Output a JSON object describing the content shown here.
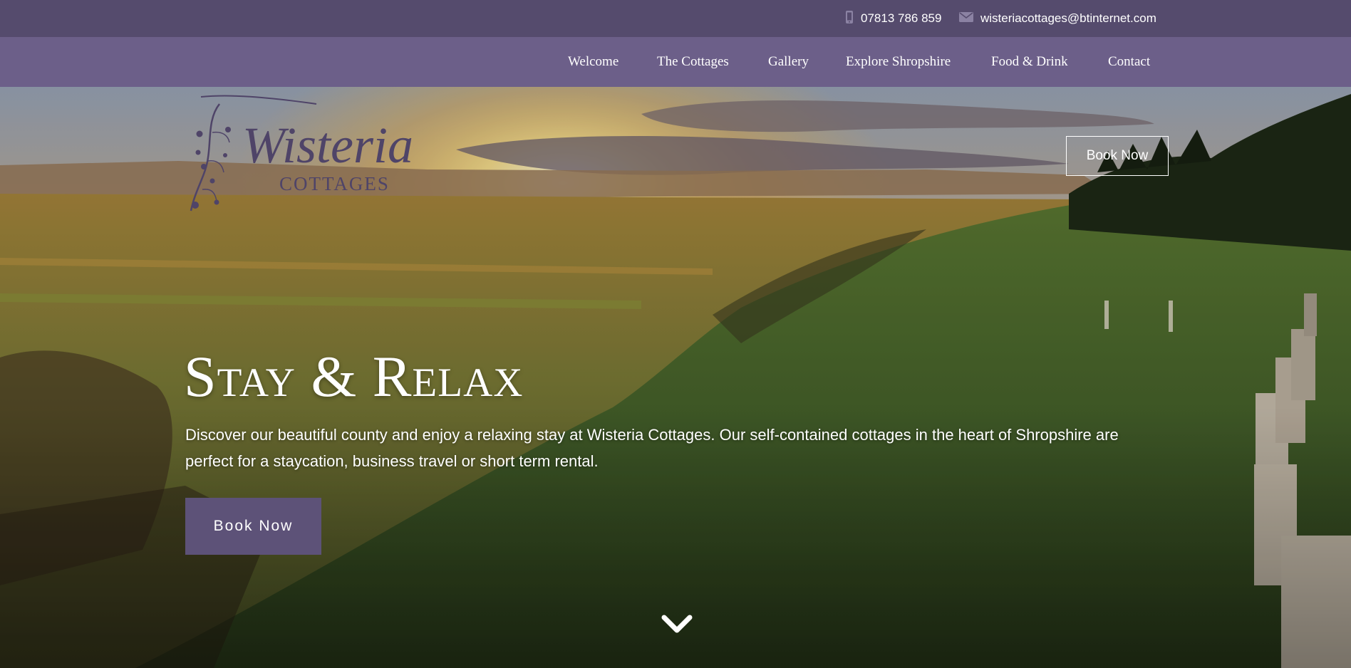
{
  "contact": {
    "phone": "07813 786 859",
    "email": "wisteriacottages@btinternet.com",
    "phone_icon": "phone-icon",
    "email_icon": "envelope-icon"
  },
  "nav": {
    "items": [
      {
        "label": "Welcome"
      },
      {
        "label": "The Cottages"
      },
      {
        "label": "Gallery"
      },
      {
        "label": "Explore Shropshire"
      },
      {
        "label": "Food & Drink"
      },
      {
        "label": "Contact"
      }
    ]
  },
  "logo": {
    "name": "Wisteria",
    "sub": "COTTAGES"
  },
  "header": {
    "book_label": "Book Now"
  },
  "hero": {
    "title": "Stay & Relax",
    "description": "Discover our beautiful county and enjoy a relaxing stay at Wisteria Cottages. Our self-contained cottages in the heart of Shropshire are perfect for a staycation, business travel or short term rental.",
    "book_label": "Book Now",
    "scroll_icon": "chevron-down-icon"
  },
  "colors": {
    "topbar": "#554b6d",
    "navbar": "#6c5f89",
    "button": "#5d5278",
    "logo": "#4f4468"
  }
}
